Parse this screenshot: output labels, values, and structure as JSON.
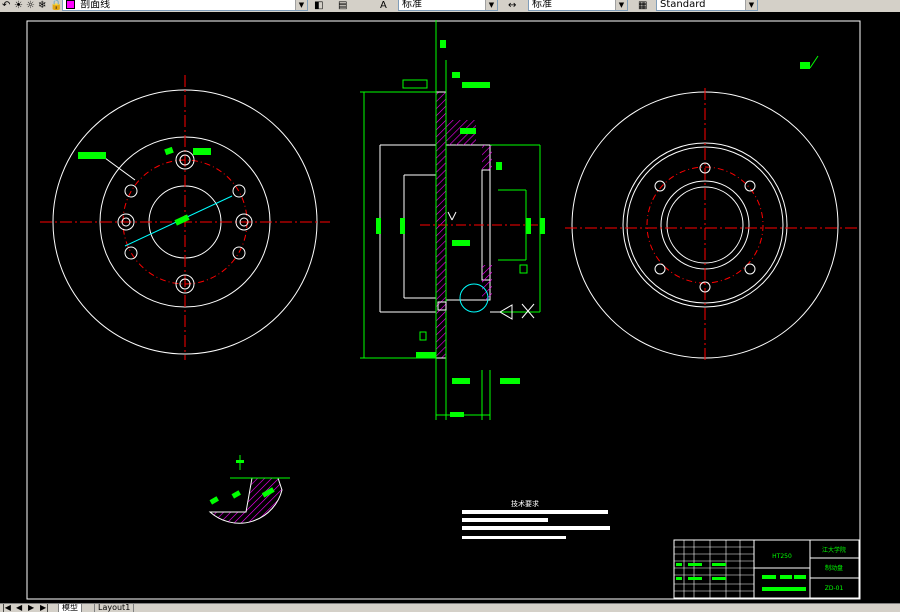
{
  "toolbar": {
    "layer_name": "剖面线",
    "layer_color": "#ff00ff",
    "text_style": "标准",
    "dim_style": "标准",
    "table_style": "Standard"
  },
  "tabs": {
    "model": "模型",
    "layout1": "Layout1"
  },
  "drawing": {
    "tech_requirements_title": "技术要求",
    "title_block": {
      "material": "HT250",
      "company": "江大学院",
      "part_name": "制动盘",
      "drawing_no": "ZD-01"
    }
  },
  "colors": {
    "background": "#000000",
    "drawing_lines": "#ffffff",
    "center_lines": "#ff0000",
    "dimensions": "#00ff00",
    "hatch": "#ff00ff",
    "annotation": "#00ffff"
  }
}
